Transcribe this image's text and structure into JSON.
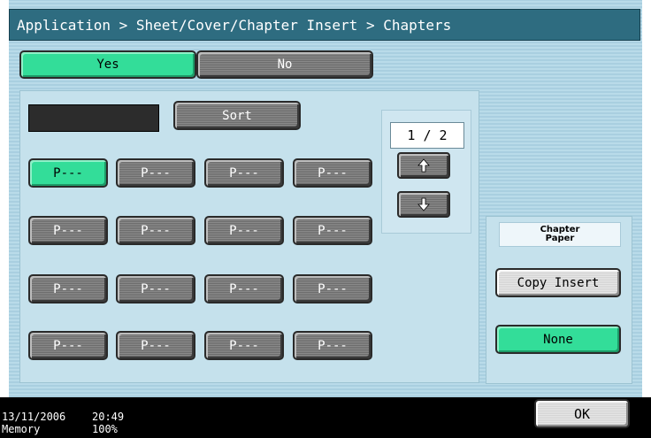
{
  "title": "Application > Sheet/Cover/Chapter Insert > Chapters",
  "toggle": {
    "yes_label": "Yes",
    "no_label": "No"
  },
  "sort_label": "Sort",
  "page_indicator": "1 / 2",
  "page_buttons": [
    "P---",
    "P---",
    "P---",
    "P---",
    "P---",
    "P---",
    "P---",
    "P---",
    "P---",
    "P---",
    "P---",
    "P---",
    "P---",
    "P---",
    "P---",
    "P---"
  ],
  "chapter_paper": {
    "heading_line1": "Chapter",
    "heading_line2": "Paper",
    "copy_insert_label": "Copy Insert",
    "none_label": "None"
  },
  "ok_label": "OK",
  "status": {
    "date": "13/11/2006",
    "time": "20:49",
    "memory_label": "Memory",
    "memory_value": "100%"
  },
  "colors": {
    "active": "#33dd99",
    "titlebar": "#2e6c80",
    "background": "#b9dbe9"
  }
}
